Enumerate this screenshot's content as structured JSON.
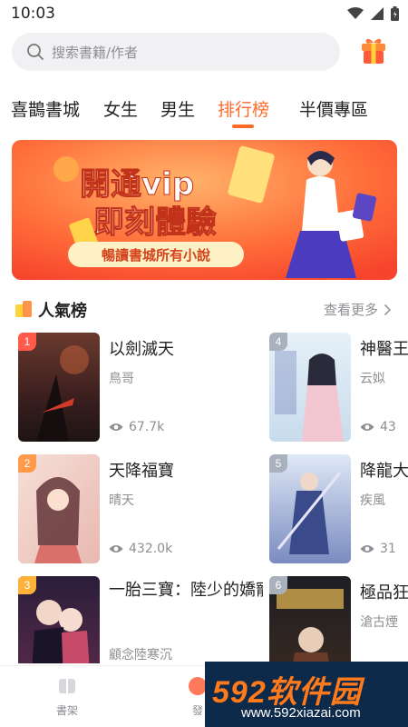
{
  "status_bar": {
    "time": "10:03"
  },
  "search": {
    "placeholder": "搜索書籍/作者"
  },
  "tabs": [
    {
      "label": "喜鵲書城"
    },
    {
      "label": "女生"
    },
    {
      "label": "男生"
    },
    {
      "label": "排行榜",
      "active": true
    },
    {
      "label": "半價專區"
    }
  ],
  "banner": {
    "headline_1": "開通vip",
    "headline_2": "即刻體驗",
    "subtitle": "暢讀書城所有小說"
  },
  "section": {
    "title": "人氣榜",
    "see_more": "查看更多"
  },
  "books": [
    {
      "rank": "1",
      "title": "以劍滅天",
      "author": "鳥哥",
      "views": "67.7k"
    },
    {
      "rank": "2",
      "title": "天降福寶",
      "author": "晴天",
      "views": "432.0k"
    },
    {
      "rank": "3",
      "title": "一胎三寶：陸少的嬌寵妻",
      "author": "顧念陸寒沉",
      "views": ""
    },
    {
      "rank": "4",
      "title": "神醫王",
      "author": "云姒",
      "views": "43"
    },
    {
      "rank": "5",
      "title": "降龍大",
      "author": "疾風",
      "views": "31"
    },
    {
      "rank": "6",
      "title": "極品狂",
      "author": "滄古煙",
      "views": ""
    }
  ],
  "bottom_nav": [
    {
      "label": "書架"
    },
    {
      "label": "發"
    }
  ],
  "watermark": {
    "brand": "592软件园",
    "url": "www.592xiazai.com"
  },
  "colors": {
    "accent": "#ff6a2b",
    "badge_1": "#ff5a4a",
    "badge_2": "#ff9a4a",
    "badge_3": "#ffb23a",
    "badge_other": "#a9b1bd"
  }
}
